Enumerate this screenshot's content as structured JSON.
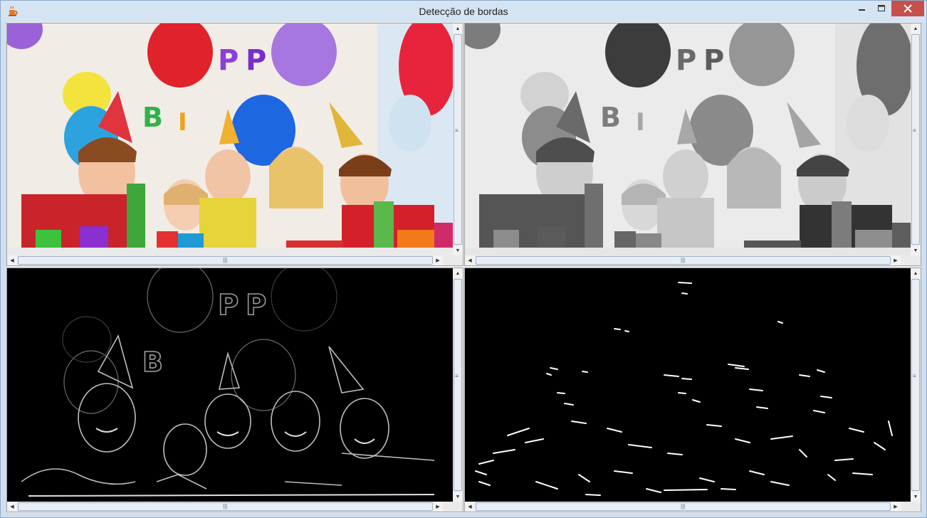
{
  "window": {
    "title": "Detecção de bordas"
  },
  "panes": [
    {
      "name": "original",
      "image": "color-party-photo"
    },
    {
      "name": "grayscale",
      "image": "grayscale-party-photo"
    },
    {
      "name": "edge-gradient",
      "image": "edge-gradient-map"
    },
    {
      "name": "edge-binary",
      "image": "binary-edge-map"
    }
  ],
  "icons": {
    "app": "java-cup-icon",
    "minimize": "minimize-icon",
    "maximize": "maximize-icon",
    "close": "close-icon",
    "scroll_up": "arrow-up-icon",
    "scroll_down": "arrow-down-icon",
    "scroll_left": "arrow-left-icon",
    "scroll_right": "arrow-right-icon"
  },
  "colors": {
    "titlebar": "#d5e4f3",
    "close_button": "#c7504b",
    "edge_background": "#000000"
  }
}
